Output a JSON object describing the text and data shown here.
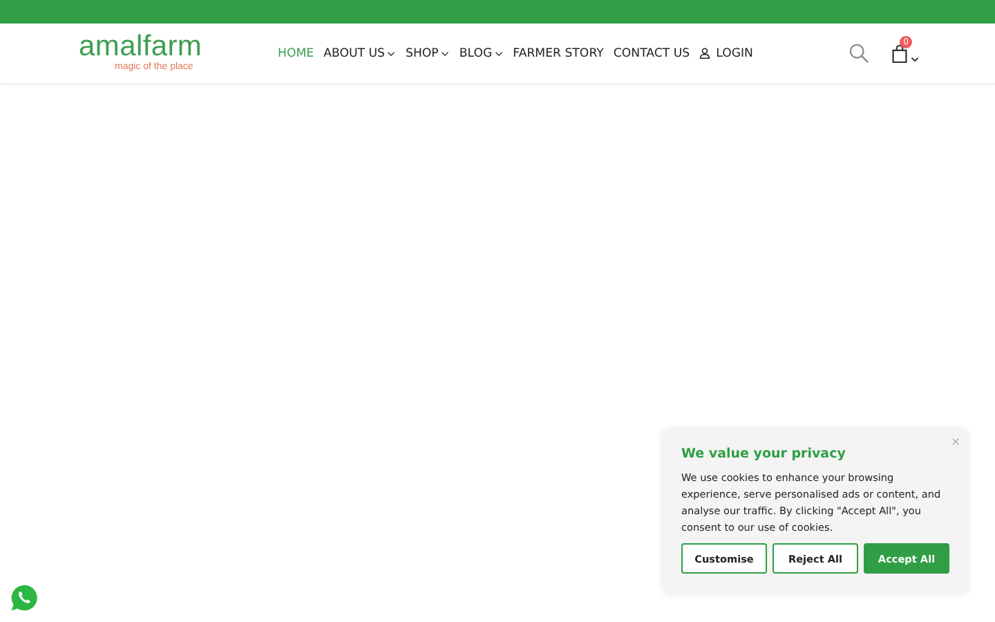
{
  "logo": {
    "name": "amalfarm",
    "tagline": "magic of the place"
  },
  "nav": [
    {
      "label": "HOME",
      "kind": "link",
      "selected": true
    },
    {
      "label": "ABOUT US",
      "kind": "dropdown",
      "selected": false
    },
    {
      "label": "SHOP",
      "kind": "dropdown",
      "selected": false
    },
    {
      "label": "BLOG",
      "kind": "dropdown",
      "selected": false
    },
    {
      "label": "FARMER STORY",
      "kind": "link",
      "selected": false
    },
    {
      "label": "CONTACT US",
      "kind": "link",
      "selected": false
    },
    {
      "label": "LOGIN",
      "kind": "account",
      "selected": false
    }
  ],
  "cart": {
    "count": "0"
  },
  "cookie_banner": {
    "title": "We value your privacy",
    "text": "We use cookies to enhance your browsing experience, serve personalised ads or content, and analyse our traffic. By clicking \"Accept All\", you consent to our use of cookies.",
    "buttons": [
      {
        "label": "Customise",
        "kind": "outline"
      },
      {
        "label": "Reject All",
        "kind": "outline"
      },
      {
        "label": "Accept All",
        "kind": "primary"
      }
    ]
  }
}
